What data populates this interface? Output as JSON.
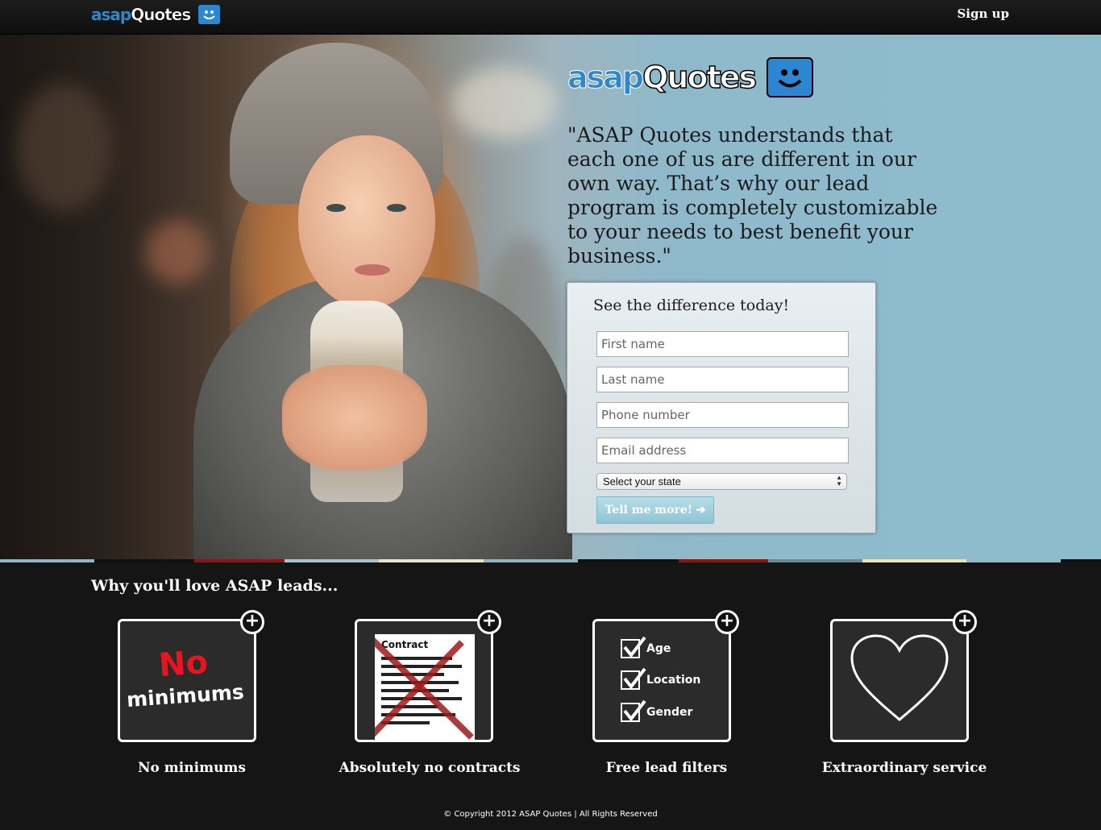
{
  "header": {
    "brand_part1": "asap",
    "brand_part2": "Quotes",
    "signup_label": "Sign up"
  },
  "hero": {
    "logo_part1": "asap",
    "logo_part2": "Quotes",
    "quote": "\"ASAP Quotes understands that each one of us are different in our own way. That’s why our lead program is completely customizable to your needs to best benefit your business.\""
  },
  "form": {
    "title": "See the difference today!",
    "first_name_placeholder": "First name",
    "last_name_placeholder": "Last name",
    "phone_placeholder": "Phone number",
    "email_placeholder": "Email address",
    "state_selected": "Select your state",
    "submit_label": "Tell me more! ➔"
  },
  "features": {
    "heading": "Why you'll love ASAP leads...",
    "items": [
      {
        "label": "No minimums",
        "tile_text_1": "No",
        "tile_text_2": "minimums"
      },
      {
        "label": "Absolutely no contracts",
        "tile_text_1": "Contract"
      },
      {
        "label": "Free lead filters",
        "filters": [
          "Age",
          "Location",
          "Gender"
        ]
      },
      {
        "label": "Extraordinary service"
      }
    ],
    "plus_icon": "+"
  },
  "footer": {
    "copyright": "© Copyright 2012 ASAP Quotes | All Rights Reserved"
  },
  "colors": {
    "brand_blue": "#2f86c9",
    "accent_red": "#e8141e",
    "button_blue": "#8ec5d5"
  }
}
